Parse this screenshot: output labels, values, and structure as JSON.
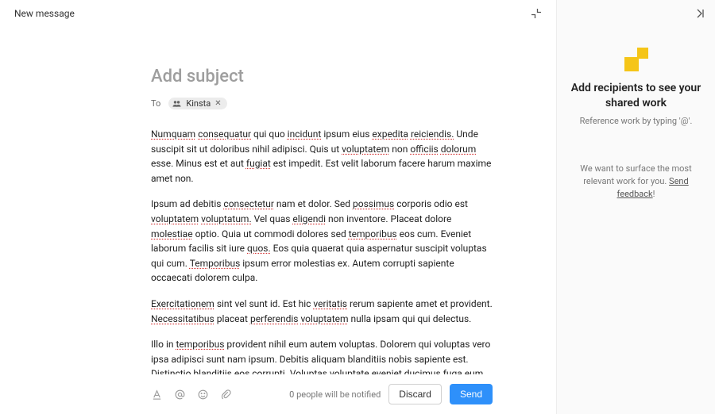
{
  "header": {
    "title": "New message"
  },
  "compose": {
    "subject_placeholder": "Add subject",
    "to_label": "To",
    "recipients": [
      {
        "name": "Kinsta"
      }
    ],
    "body_paragraphs": [
      "Numquam consequatur qui quo incidunt ipsum eius expedita reiciendis. Unde suscipit sit ut doloribus nihil adipisci. Quis ut voluptatem non officiis dolorum esse. Minus est et aut fugiat est impedit. Est velit laborum facere harum maxime amet non.",
      "Ipsum ad debitis consectetur nam et dolor. Sed possimus corporis odio est voluptatem voluptatum. Vel quas eligendi non inventore. Placeat dolore molestiae optio. Quia ut commodi dolores sed temporibus eos cum. Eveniet laborum facilis sit iure quos. Eos quia quaerat quia aspernatur suscipit voluptas qui cum. Temporibus ipsum error molestias ex. Autem corrupti sapiente occaecati dolorem culpa.",
      "Exercitationem sint vel sunt id. Est hic veritatis rerum sapiente amet et provident. Necessitatibus placeat perferendis voluptatem nulla ipsam qui qui delectus.",
      "Illo in temporibus provident nihil eum autem voluptas. Dolorem qui voluptas vero ipsa adipisci sunt nam ipsum. Debitis aliquam blanditiis nobis sapiente est. Distinctio blanditiis eos corrupti. Voluptas voluptate eveniet ducimus fuga eum doloremque et rerum. Adipisci ut dolor reprehenderit beatae voluptatem iste amet commodi."
    ]
  },
  "footer": {
    "notified_text": "0 people will be notified",
    "discard_label": "Discard",
    "send_label": "Send"
  },
  "sidebar": {
    "title": "Add recipients to see your shared work",
    "subtitle": "Reference work by typing '@'.",
    "note_prefix": "We want to surface the most relevant work for you. ",
    "note_link": "Send feedback",
    "note_suffix": "!"
  }
}
